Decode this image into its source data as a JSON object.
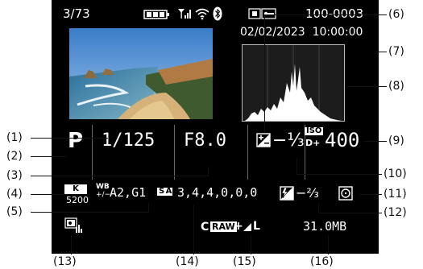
{
  "playback": {
    "frame_counter": "3/73",
    "folder_file": "100-0003",
    "datetime": "02/02/2023  10:00:00"
  },
  "status_icons": [
    "battery-icon",
    "signal-icon",
    "wifi-icon",
    "bluetooth-icon",
    "protect-icon"
  ],
  "exposure": {
    "mode": "P",
    "shutter": "1/125",
    "aperture": "F8.0",
    "exposure_comp": "−⅓",
    "iso_label": "ISO",
    "iso_sub": "D+",
    "iso": "400"
  },
  "white_balance": {
    "icon_letter": "K",
    "kelvin": "5200",
    "wb_top": "WB",
    "wb_bottom": "+/−",
    "shift": "A2,G1"
  },
  "picture_style": {
    "icon_label": "S A",
    "params": "3,4,4,0,0,0"
  },
  "flash_comp": "−⅔",
  "quality": {
    "raw_label": "RAW",
    "raw_prefix": "C",
    "plus": "+",
    "jpeg_size": "L"
  },
  "file_size": "31.0MB",
  "callouts": [
    "(1)",
    "(2)",
    "(3)",
    "(4)",
    "(5)",
    "(6)",
    "(7)",
    "(8)",
    "(9)",
    "(10)",
    "(11)",
    "(12)",
    "(13)",
    "(14)",
    "(15)",
    "(16)"
  ],
  "colors": {
    "screen": "#000000",
    "text": "#ffffff",
    "callout": "#111111"
  }
}
